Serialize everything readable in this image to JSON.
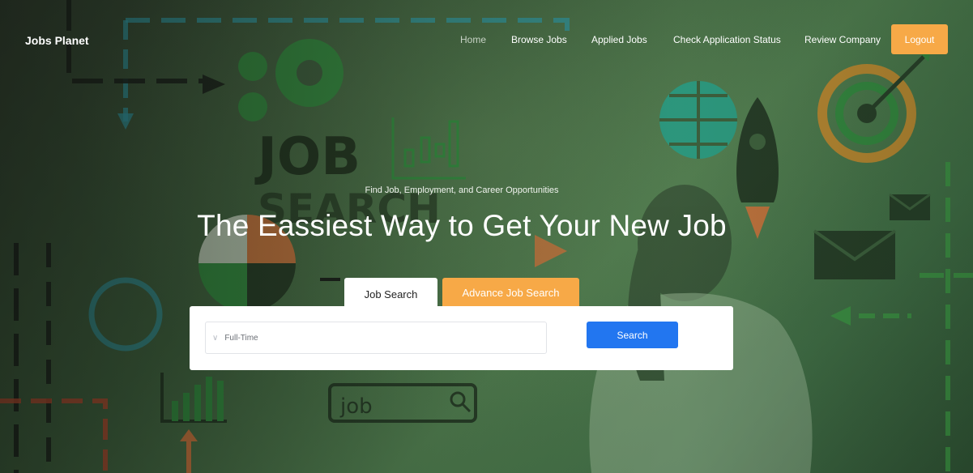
{
  "brand": {
    "name": "Jobs Planet"
  },
  "nav": {
    "items": [
      {
        "label": "Home"
      },
      {
        "label": "Browse Jobs"
      },
      {
        "label": "Applied Jobs"
      },
      {
        "label": "Check Application Status"
      },
      {
        "label": "Review Company"
      }
    ],
    "logout_label": "Logout"
  },
  "hero": {
    "tagline": "Find Job, Employment, and Career Opportunities",
    "headline": "The Eassiest Way to Get Your New Job",
    "background_text": {
      "top": "JOB",
      "bottom": "SEARCH",
      "box": "job"
    }
  },
  "search": {
    "tabs": [
      {
        "label": "Job Search",
        "active": true
      },
      {
        "label": "Advance Job Search",
        "active": false
      }
    ],
    "job_type_selected": "Full-Time",
    "button_label": "Search"
  },
  "colors": {
    "accent_orange": "#f7a947",
    "primary_blue": "#2276f0",
    "overlay_green": "#3f6a44"
  }
}
